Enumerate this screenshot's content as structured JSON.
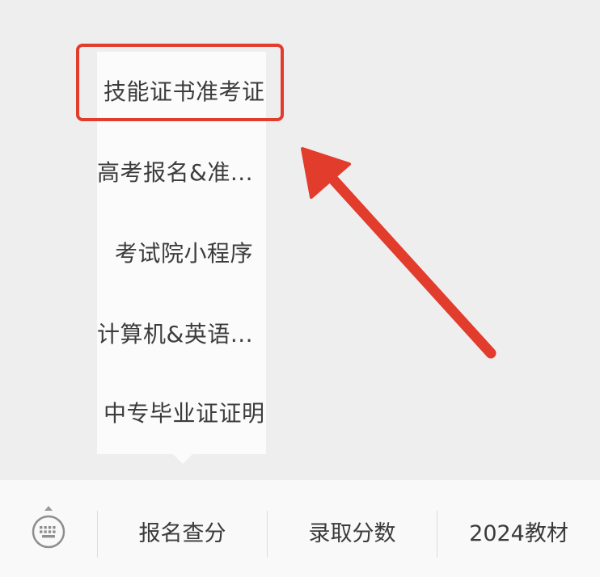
{
  "submenu": {
    "items": [
      {
        "label": "技能证书准考证",
        "highlighted": true
      },
      {
        "label": "高考报名&准..."
      },
      {
        "label": "考试院小程序"
      },
      {
        "label": "计算机&英语..."
      },
      {
        "label": "中专毕业证证明"
      }
    ]
  },
  "bottom_menu": {
    "keyboard_icon": "keyboard-icon",
    "tabs": [
      {
        "label": "报名查分"
      },
      {
        "label": "录取分数"
      },
      {
        "label": "2024教材"
      }
    ]
  },
  "annotation": {
    "color": "#e23c2c",
    "arrow_icon": "red-arrow"
  }
}
